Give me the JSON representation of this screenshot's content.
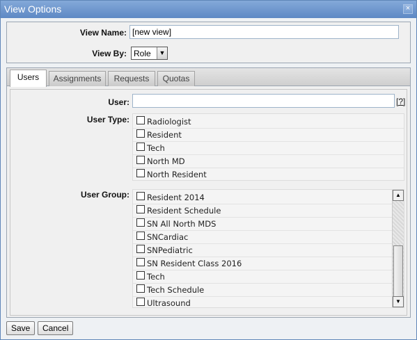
{
  "window": {
    "title": "View Options",
    "close_glyph": "×"
  },
  "view_name": {
    "label": "View Name:",
    "value": "[new view]"
  },
  "view_by": {
    "label": "View By:",
    "selected": "Role"
  },
  "tabs": [
    {
      "label": "Users",
      "active": true
    },
    {
      "label": "Assignments",
      "active": false
    },
    {
      "label": "Requests",
      "active": false
    },
    {
      "label": "Quotas",
      "active": false
    }
  ],
  "user": {
    "label": "User:",
    "value": "",
    "help": "[?]"
  },
  "user_type": {
    "label": "User Type:",
    "items": [
      "Radiologist",
      "Resident",
      "Tech",
      "North MD",
      "North Resident"
    ]
  },
  "user_group": {
    "label": "User Group:",
    "items": [
      "Resident 2014",
      "Resident Schedule",
      "SN All North MDS",
      "SNCardiac",
      "SNPediatric",
      "SN Resident Class 2016",
      "Tech",
      "Tech Schedule",
      "Ultrasound"
    ],
    "scroll_position": 1.0
  },
  "buttons": {
    "save": "Save",
    "cancel": "Cancel"
  },
  "icons": {
    "close": "close-icon",
    "dropdown": "chevron-down-icon",
    "scroll_up": "arrow-up-icon",
    "scroll_down": "arrow-down-icon"
  },
  "colors": {
    "titlebar": "#6b93cb",
    "panel": "#f0f0f0",
    "border": "#9aa5b1"
  }
}
